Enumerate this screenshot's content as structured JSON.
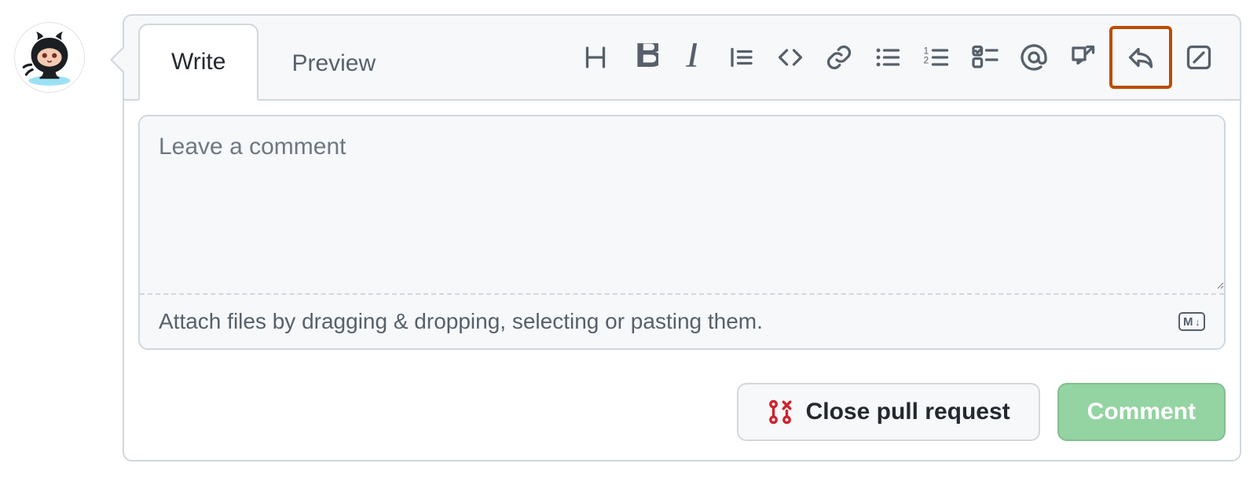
{
  "tabs": {
    "write": "Write",
    "preview": "Preview"
  },
  "toolbar": {
    "heading": "heading-icon",
    "bold": "bold-icon",
    "italic": "italic-icon",
    "quote": "quote-icon",
    "code": "code-icon",
    "link": "link-icon",
    "ul": "unordered-list-icon",
    "ol": "ordered-list-icon",
    "tasklist": "task-list-icon",
    "mention": "mention-icon",
    "reference": "cross-reference-icon",
    "reply": "reply-icon",
    "suggest": "diff-ignored-icon"
  },
  "textarea": {
    "placeholder": "Leave a comment",
    "value": ""
  },
  "attach": {
    "hint": "Attach files by dragging & dropping, selecting or pasting them.",
    "badge": "M↓"
  },
  "buttons": {
    "close": "Close pull request",
    "comment": "Comment"
  }
}
